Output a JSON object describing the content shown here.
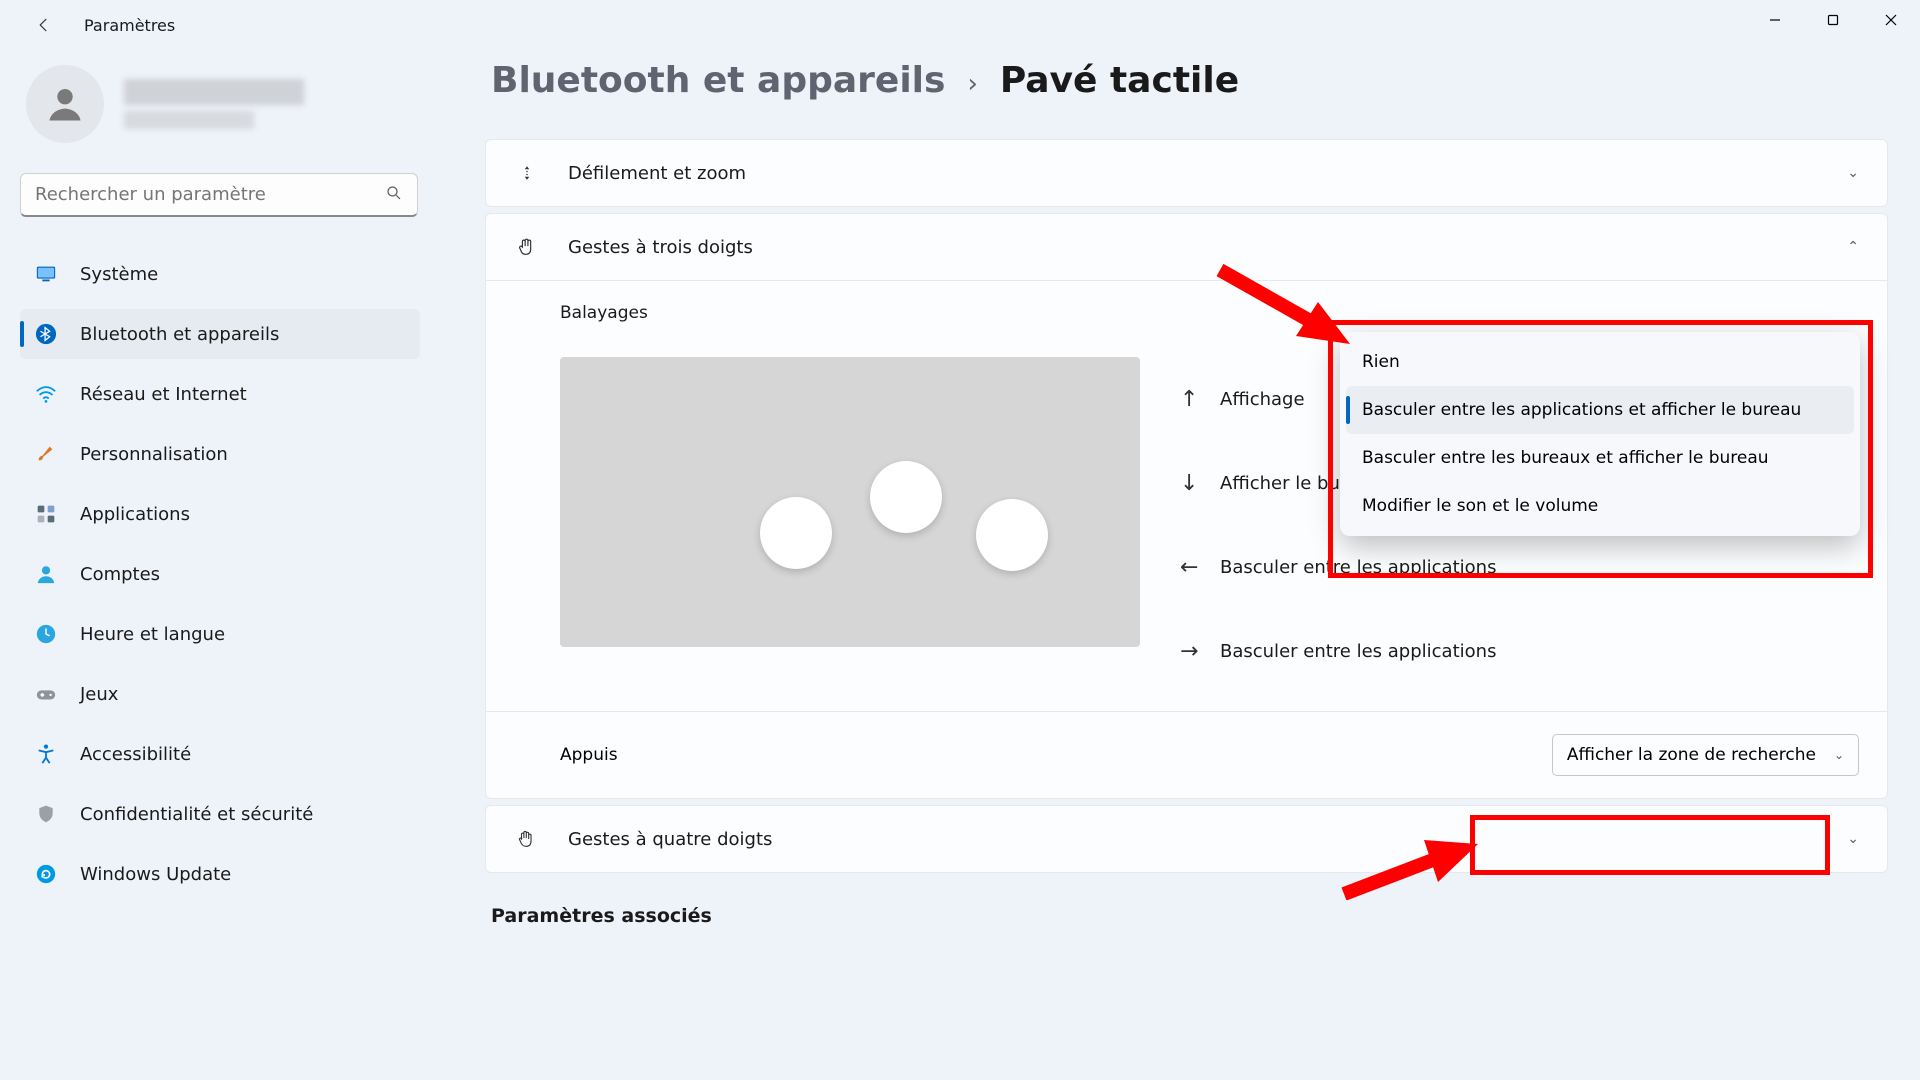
{
  "app_title": "Paramètres",
  "search_placeholder": "Rechercher un paramètre",
  "sidebar": {
    "items": [
      {
        "label": "Système"
      },
      {
        "label": "Bluetooth et appareils"
      },
      {
        "label": "Réseau et Internet"
      },
      {
        "label": "Personnalisation"
      },
      {
        "label": "Applications"
      },
      {
        "label": "Comptes"
      },
      {
        "label": "Heure et langue"
      },
      {
        "label": "Jeux"
      },
      {
        "label": "Accessibilité"
      },
      {
        "label": "Confidentialité et sécurité"
      },
      {
        "label": "Windows Update"
      }
    ]
  },
  "breadcrumb": {
    "parent": "Bluetooth et appareils",
    "current": "Pavé tactile"
  },
  "cards": {
    "scroll_zoom": "Défilement et zoom",
    "three_finger": "Gestes à trois doigts",
    "swipes_label": "Balayages",
    "directions": {
      "up": "Affichage",
      "down": "Afficher le bureau",
      "left": "Basculer entre les applications",
      "right": "Basculer entre les applications"
    },
    "taps_label": "Appuis",
    "taps_value": "Afficher la zone de recherche",
    "four_finger": "Gestes à quatre doigts"
  },
  "flyout": {
    "options": [
      "Rien",
      "Basculer entre les applications et afficher le bureau",
      "Basculer entre les bureaux et afficher le bureau",
      "Modifier le son et le volume"
    ]
  },
  "assoc_heading": "Paramètres associés"
}
